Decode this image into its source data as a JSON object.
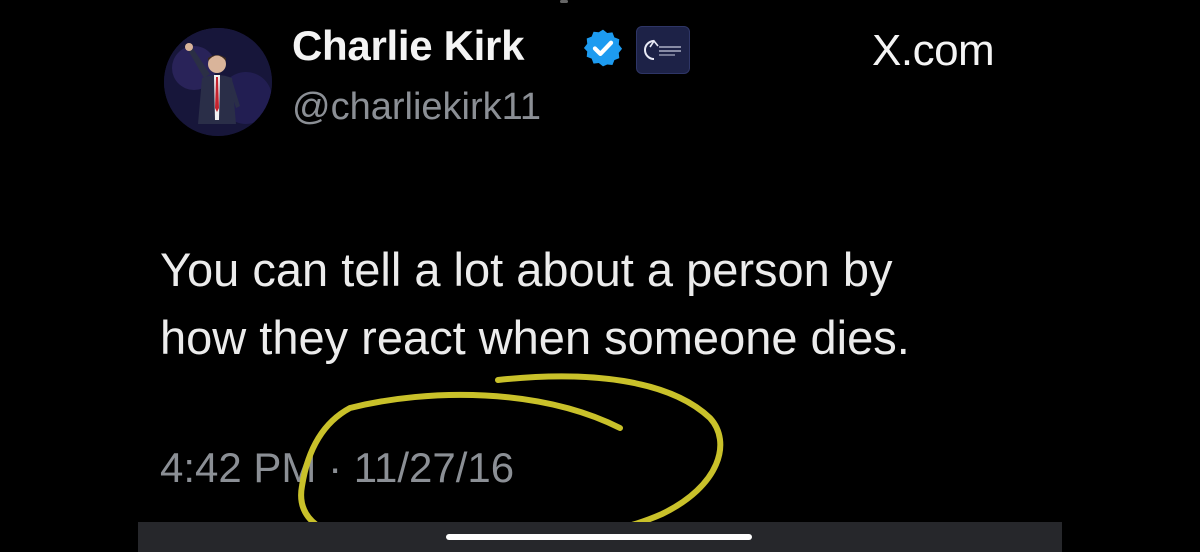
{
  "tweet": {
    "display_name": "Charlie Kirk",
    "handle": "@charliekirk11",
    "verified": true,
    "verified_color": "#1d9bf0",
    "affiliate_badge_icon": "turning-point-usa-badge",
    "site_label": "X.com",
    "text_lines": [
      "You can tell a lot about a person by",
      "how they react when someone dies."
    ],
    "timestamp": "4:42 PM · 11/27/16"
  },
  "annotation": {
    "type": "hand-drawn-circle",
    "color": "#c9c12a",
    "target": "timestamp"
  },
  "colors": {
    "background": "#000000",
    "primary_text": "#ececec",
    "secondary_text": "#8b8f95"
  }
}
